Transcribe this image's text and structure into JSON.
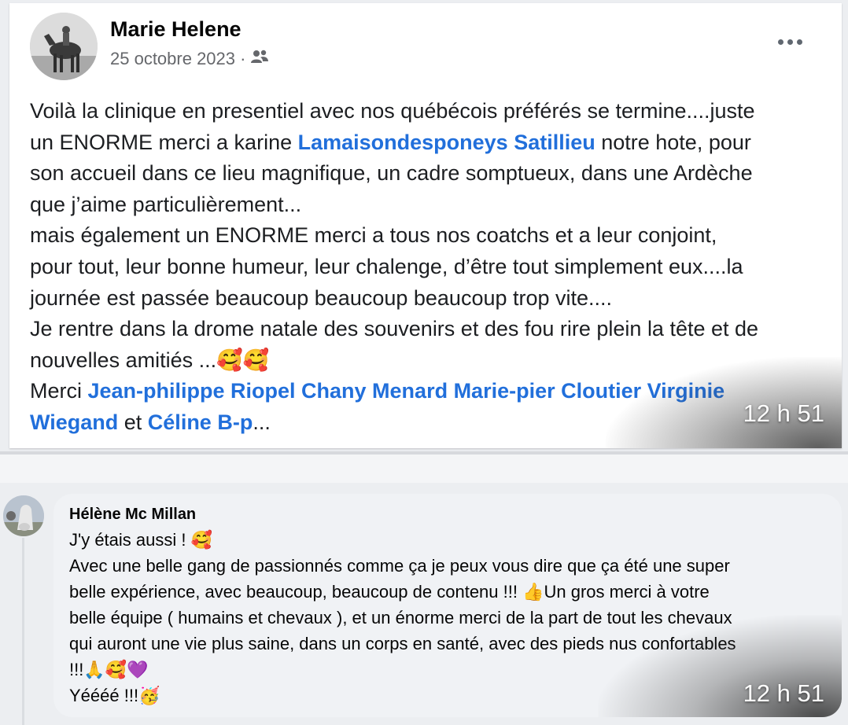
{
  "post": {
    "author": "Marie Helene",
    "date": "25 octobre 2023 ·",
    "audience_icon": "friends-icon",
    "menu_icon": "more-options-icon",
    "body": {
      "l1": "Voilà la clinique en presentiel avec nos québécois préférés se termine....juste",
      "l2_a": "un ENORME merci a karine ",
      "l2_tag": "Lamaisondesponeys Satillieu",
      "l2_b": " notre hote, pour",
      "l3": "son accueil dans ce lieu magnifique, un cadre somptueux, dans une Ardèche",
      "l4": "que j’aime particulièrement...",
      "l5": "mais également un ENORME merci a tous nos coatchs et a leur conjoint,",
      "l6": "pour tout, leur bonne humeur, leur chalenge, d’être tout simplement eux....la",
      "l7": "journée est passée beaucoup beaucoup beaucoup trop vite....",
      "l8": "Je rentre dans la drome natale des souvenirs et des fou rire plein la tête et de",
      "l9": "nouvelles amitiés ...",
      "l9_emoji": "🥰🥰",
      "l10_a": "Merci ",
      "l10_tag": "Jean-philippe Riopel Chany Menard Marie-pier Cloutier Virginie",
      "l11_tag1": "Wiegand",
      "l11_mid": " et ",
      "l11_tag2": "Céline B-p",
      "l11_end": "..."
    },
    "overlay_time": "12 h 51"
  },
  "comment": {
    "author": "Hélène Mc Millan",
    "body": {
      "l1": "J'y étais aussi ! ",
      "l1_emoji": "🥰",
      "l2": "Avec une belle gang de passionnés comme ça je peux vous dire que ça été une super",
      "l3": "belle expérience, avec beaucoup, beaucoup de contenu !!! ",
      "l3_emoji": "👍",
      "l3_b": "Un gros merci à votre",
      "l4": "belle équipe ( humains et chevaux ), et un énorme merci de la part de tout les chevaux",
      "l5": "qui auront une vie plus saine, dans un corps en santé, avec des pieds nus confortables",
      "l6": "!!!",
      "l6_emoji": "🙏🥰💜",
      "l7": "Yéééé !!!",
      "l7_emoji": "🥳"
    },
    "overlay_time": "12 h 51"
  },
  "colors": {
    "link": "#216fdb",
    "secondary_text": "#65676b",
    "bubble": "#f0f2f5"
  }
}
